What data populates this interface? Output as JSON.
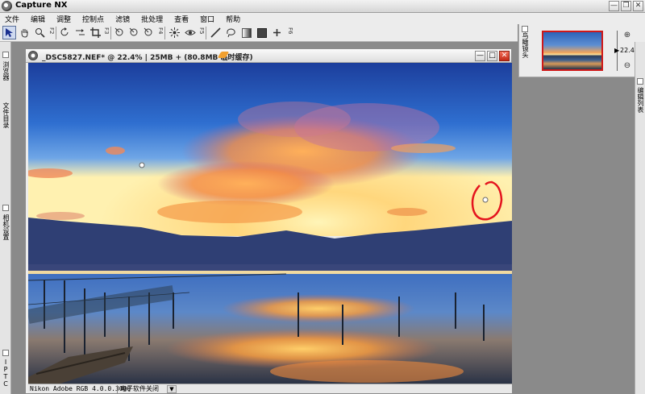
{
  "app": {
    "title": "Capture NX"
  },
  "window_buttons": [
    "—",
    "❐",
    "✕"
  ],
  "menu": [
    "文件",
    "编辑",
    "调整",
    "控制点",
    "滤镜",
    "批处理",
    "查看",
    "窗口",
    "帮助"
  ],
  "toolbar": {
    "tools": [
      "direct-select",
      "hand",
      "zoom",
      "rotate",
      "straighten",
      "crop",
      "color-control-point",
      "black-control-point",
      "white-control-point",
      "red-eye",
      "eye",
      "line",
      "lasso",
      "gradient",
      "fill",
      "plus"
    ],
    "fkeys": [
      "F2",
      "F3",
      "F4",
      "F5",
      "F6"
    ]
  },
  "left_panel": {
    "tabs": [
      "浏览器",
      "文件目录",
      "相机设置",
      "IPTC"
    ]
  },
  "navigator": {
    "label": "鸟瞰镜头",
    "zoom": "22.4 %"
  },
  "right_panel": {
    "label": "编辑列表"
  },
  "document": {
    "title": "_DSC5827.NEF* @ 22.4% | 25MB + (80.8MB 临时缓存)",
    "color_profile": "Nikon Adobe RGB 4.0.0.3000",
    "status_message": "电子软件关闭"
  },
  "colors": {
    "annotation": "#e4141e",
    "sky_top": "#1c3e9c",
    "sunset": "#f6a13c"
  }
}
